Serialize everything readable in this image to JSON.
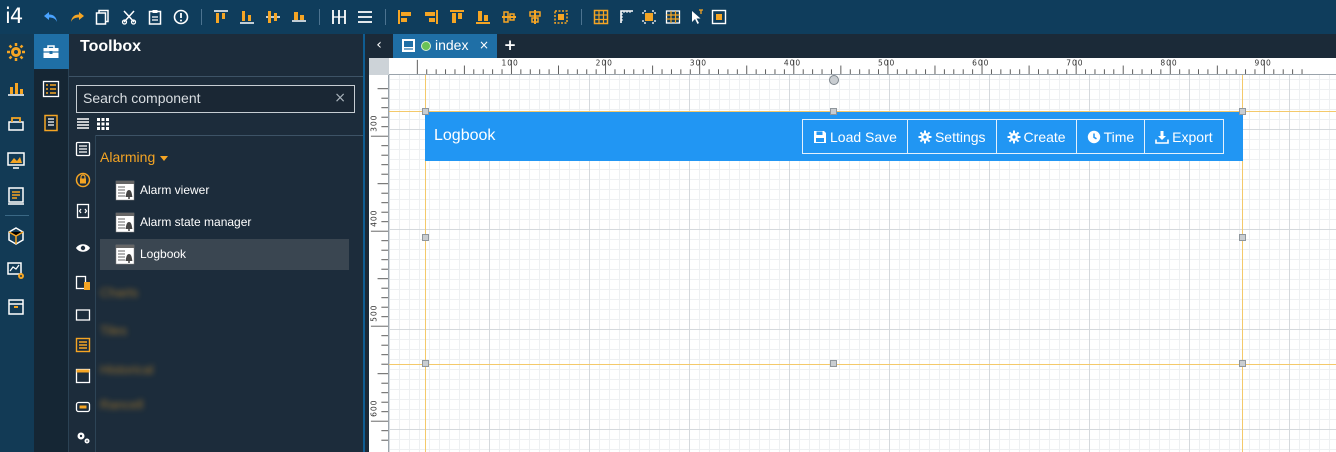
{
  "app": {
    "logo": "i4"
  },
  "toolbox": {
    "title": "Toolbox",
    "search_placeholder": "Search component",
    "clear_glyph": "×",
    "category": "Alarming",
    "components": [
      {
        "label": "Alarm viewer"
      },
      {
        "label": "Alarm state manager"
      },
      {
        "label": "Logbook",
        "selected": true
      }
    ],
    "blurred_categories": [
      "Charts",
      "Tiles",
      "Historical",
      "Rancell"
    ]
  },
  "tabs": {
    "back_glyph": "‹",
    "active_tab": "index",
    "close_glyph": "×",
    "add_glyph": "+"
  },
  "ruler": {
    "top_labels": [
      "100",
      "200",
      "300",
      "400",
      "500",
      "600",
      "700",
      "800",
      "900"
    ],
    "left_labels": [
      "300",
      "400",
      "500",
      "600"
    ]
  },
  "logbook": {
    "title": "Logbook",
    "buttons": [
      {
        "label": "Load Save",
        "icon": "floppy-icon"
      },
      {
        "label": "Settings",
        "icon": "gear-icon"
      },
      {
        "label": "Create",
        "icon": "gear-icon"
      },
      {
        "label": "Time",
        "icon": "clock-icon"
      },
      {
        "label": "Export",
        "icon": "download-icon"
      }
    ]
  },
  "colors": {
    "accent": "#f5a524",
    "toolbar": "#0f3d5c",
    "widget": "#2196f3",
    "active_tab": "#1f6fa6"
  }
}
